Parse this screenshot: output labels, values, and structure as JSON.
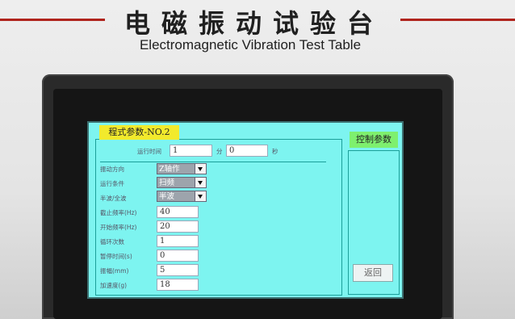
{
  "header": {
    "title_cn": "电磁振动试验台",
    "title_en": "Electromagnetic Vibration Test Table"
  },
  "screen": {
    "tab_title": "程式参数-NO.2",
    "control_tab": "控制参数",
    "return_button": "返回",
    "runtime": {
      "label": "运行时间",
      "minutes": "1",
      "minute_unit": "分",
      "seconds": "0",
      "second_unit": "秒"
    },
    "dropdowns": [
      {
        "label": "振动方向",
        "value": "Z轴作"
      },
      {
        "label": "运行条件",
        "value": "扫频"
      },
      {
        "label": "半波/全波",
        "value": "半波"
      }
    ],
    "fields": [
      {
        "label": "截止频率(Hz)",
        "value": "40"
      },
      {
        "label": "开始频率(Hz)",
        "value": "20"
      },
      {
        "label": "循环次数",
        "value": "1"
      },
      {
        "label": "暂停时间(s)",
        "value": "0"
      },
      {
        "label": "振幅(mm)",
        "value": "5"
      },
      {
        "label": "加速度(g)",
        "value": "18"
      }
    ]
  }
}
